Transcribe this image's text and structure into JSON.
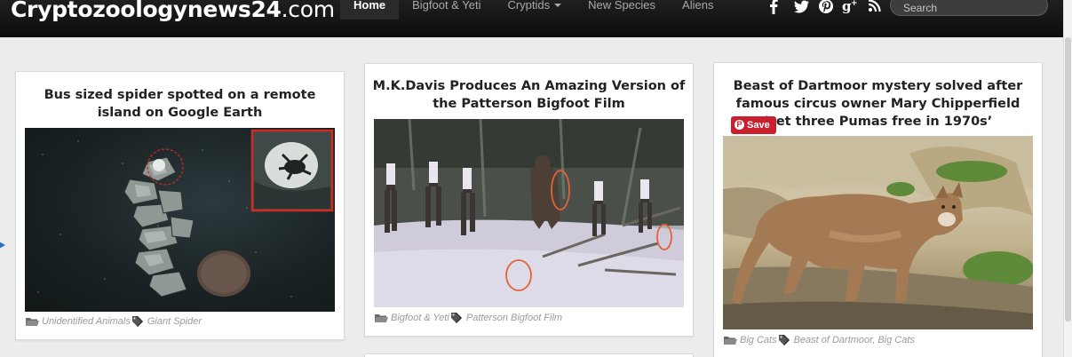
{
  "site": {
    "name_main": "Cryptozoologynews24",
    "name_tld": ".com"
  },
  "nav": {
    "items": [
      {
        "label": "Home",
        "active": true
      },
      {
        "label": "Bigfoot & Yeti",
        "active": false
      },
      {
        "label": "Cryptids",
        "active": false,
        "dropdown": true
      },
      {
        "label": "New Species",
        "active": false
      },
      {
        "label": "Aliens",
        "active": false
      }
    ]
  },
  "social": [
    {
      "icon": "facebook-icon",
      "glyph": "f"
    },
    {
      "icon": "twitter-icon",
      "glyph": "t"
    },
    {
      "icon": "pinterest-icon",
      "glyph": "p"
    },
    {
      "icon": "google-plus-icon",
      "glyph": "g+"
    },
    {
      "icon": "rss-icon",
      "glyph": "rss"
    }
  ],
  "search": {
    "placeholder": "Search"
  },
  "colors": {
    "topbar": "#111111",
    "accent_save": "#c8202e",
    "circle_marker": "#e2633a",
    "link_arrow": "#2a6ec2"
  },
  "cards": [
    {
      "title": "Bus sized spider spotted on a remote island on Google Earth",
      "category": "Unidentified Animals",
      "tags": "Giant Spider"
    },
    {
      "title": "M.K.Davis Produces An Amazing Version of the Patterson Bigfoot Film",
      "category": "Bigfoot & Yeti",
      "tags": "Patterson Bigfoot Film"
    },
    {
      "title": "Beast of Dartmoor mystery solved after famous circus owner Mary Chipperfield ‘set three Pumas free in 1970s’",
      "category": "Big Cats",
      "tags": "Beast of Dartmoor, Big Cats",
      "save_label": "Save"
    }
  ]
}
